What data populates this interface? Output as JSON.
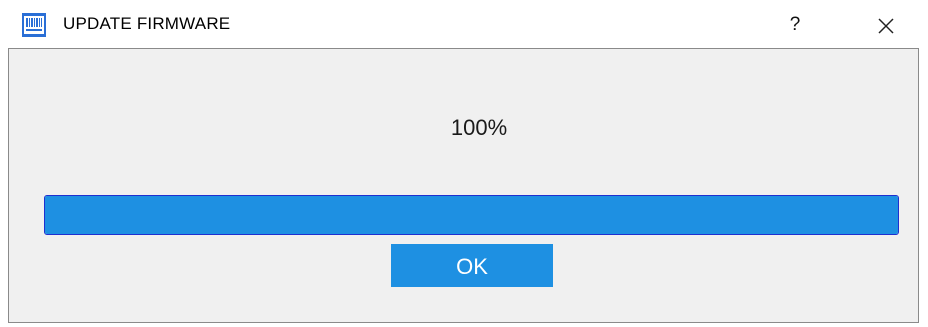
{
  "window": {
    "title": "UPDATE FIRMWARE",
    "help_label": "?"
  },
  "icons": {
    "app": "barcode-icon",
    "close": "close-icon"
  },
  "progress": {
    "label": "100%",
    "value": 1.0
  },
  "buttons": {
    "ok_label": "OK"
  },
  "colors": {
    "accent": "#1e90e2",
    "progress_border": "#1f2fd0",
    "client_bg": "#f0f0f0"
  }
}
